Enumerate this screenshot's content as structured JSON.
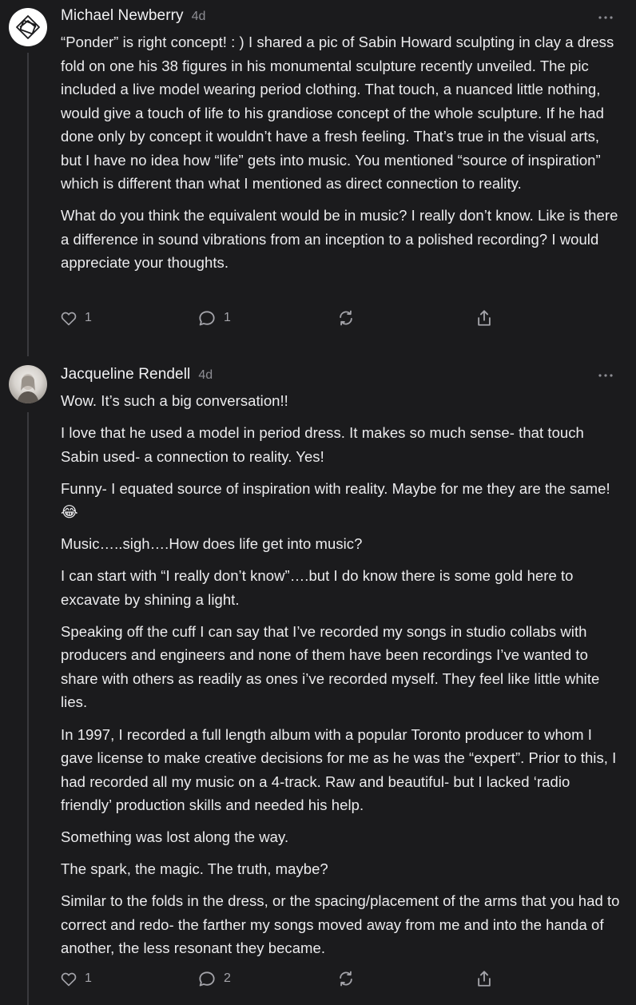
{
  "comments": [
    {
      "author": "Michael Newberry",
      "time": "4d",
      "paragraphs": [
        "“Ponder” is right concept! : ) I shared a pic of Sabin Howard sculpting in clay a dress fold on one his 38 figures in his monumental sculpture recently unveiled. The pic included a live model wearing period clothing. That touch, a nuanced little nothing, would give a touch of life to his grandiose concept of the whole sculpture. If he had done only by concept it wouldn’t have a fresh feeling. That’s true in the visual arts, but I have no idea how “life” gets into music. You mentioned “source of inspiration” which is different than what I mentioned as direct connection to reality.",
        "What do you think the equivalent would be in music? I really don’t know. Like is there a difference in sound vibrations from an inception to a polished recording? I would appreciate your thoughts."
      ],
      "likes": "1",
      "replies": "1"
    },
    {
      "author": "Jacqueline Rendell",
      "time": "4d",
      "paragraphs": [
        "Wow. It’s such a big conversation!!",
        "I love that he used a model in period dress. It makes so much sense- that touch Sabin used- a connection to reality. Yes!",
        "Funny- I equated source of inspiration with reality. Maybe for me they are the same! 😂",
        "Music…..sigh….How does life get into music?",
        "I can start with “I really don’t know”….but I do know there is some gold here to excavate by shining a light.",
        "Speaking off the cuff I can say that I’ve recorded my songs in studio collabs with producers and engineers and none of them have been recordings I’ve wanted to share with others as readily as ones i’ve recorded myself. They feel like little white lies.",
        "In 1997, I recorded a full length album with a popular Toronto producer to whom I gave license to make creative decisions for me as he was the “expert”. Prior to this, I had recorded all my music on a 4-track. Raw and beautiful- but I lacked ‘radio friendly’ production skills and needed his help.",
        "Something was lost along the way.",
        "The spark, the magic. The truth, maybe?",
        "Similar to the folds in the dress, or the spacing/placement of the arms that you had to correct and redo- the farther my songs moved away from me and into the handa of another, the less resonant they became."
      ],
      "likes": "1",
      "replies": "2"
    }
  ],
  "icons": {
    "like": "heart-icon",
    "reply": "speech-bubble-icon",
    "restack": "restack-icon",
    "share": "share-icon",
    "more": "ellipsis-icon",
    "avatar_1": "geometric-logo",
    "avatar_2": "profile-photo"
  },
  "colors": {
    "background": "#1b1b1d",
    "text": "#ececee",
    "muted": "#8d8d93",
    "icon": "#a4a4aa",
    "thread_line": "#3a3a3e"
  }
}
